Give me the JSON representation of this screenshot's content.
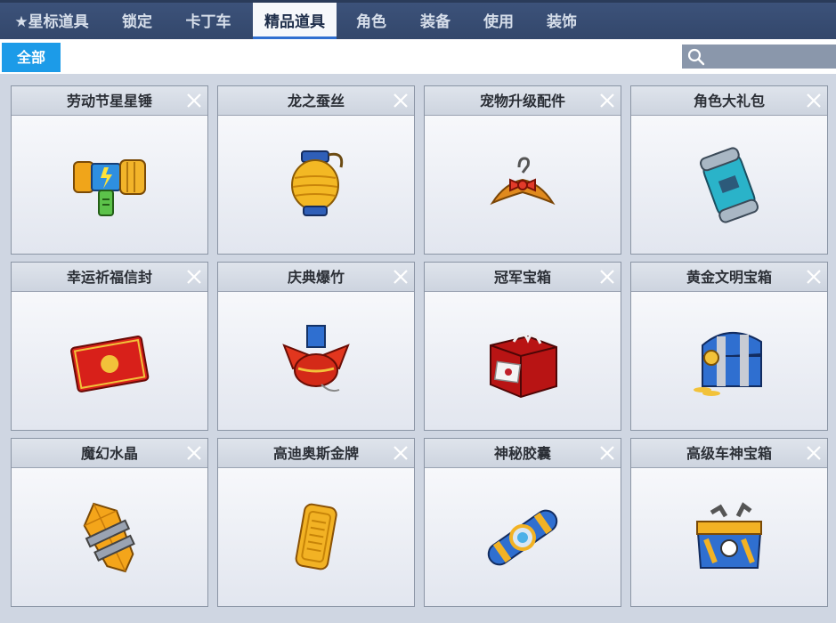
{
  "tabs": [
    {
      "label": "★星标道具",
      "active": false
    },
    {
      "label": "锁定",
      "active": false
    },
    {
      "label": "卡丁车",
      "active": false
    },
    {
      "label": "精品道具",
      "active": true
    },
    {
      "label": "角色",
      "active": false
    },
    {
      "label": "装备",
      "active": false
    },
    {
      "label": "使用",
      "active": false
    },
    {
      "label": "装饰",
      "active": false
    }
  ],
  "filter": {
    "all_label": "全部",
    "search_value": ""
  },
  "items": [
    {
      "name": "劳动节星星锤",
      "icon": "hammer-icon"
    },
    {
      "name": "龙之蚕丝",
      "icon": "silk-lantern-icon"
    },
    {
      "name": "宠物升级配件",
      "icon": "hanger-bow-icon"
    },
    {
      "name": "角色大礼包",
      "icon": "capsule-gift-icon"
    },
    {
      "name": "幸运祈福信封",
      "icon": "red-envelope-icon"
    },
    {
      "name": "庆典爆竹",
      "icon": "firecracker-icon"
    },
    {
      "name": "冠军宝箱",
      "icon": "gift-box-icon"
    },
    {
      "name": "黄金文明宝箱",
      "icon": "treasure-chest-icon"
    },
    {
      "name": "魔幻水晶",
      "icon": "crystal-icon"
    },
    {
      "name": "高迪奥斯金牌",
      "icon": "gold-plate-icon"
    },
    {
      "name": "神秘胶囊",
      "icon": "capsule-icon"
    },
    {
      "name": "高级车神宝箱",
      "icon": "car-god-chest-icon"
    }
  ],
  "colors": {
    "accent": "#1c9be8",
    "tabbar": "#3c527a",
    "card_border": "#8b95a5"
  }
}
